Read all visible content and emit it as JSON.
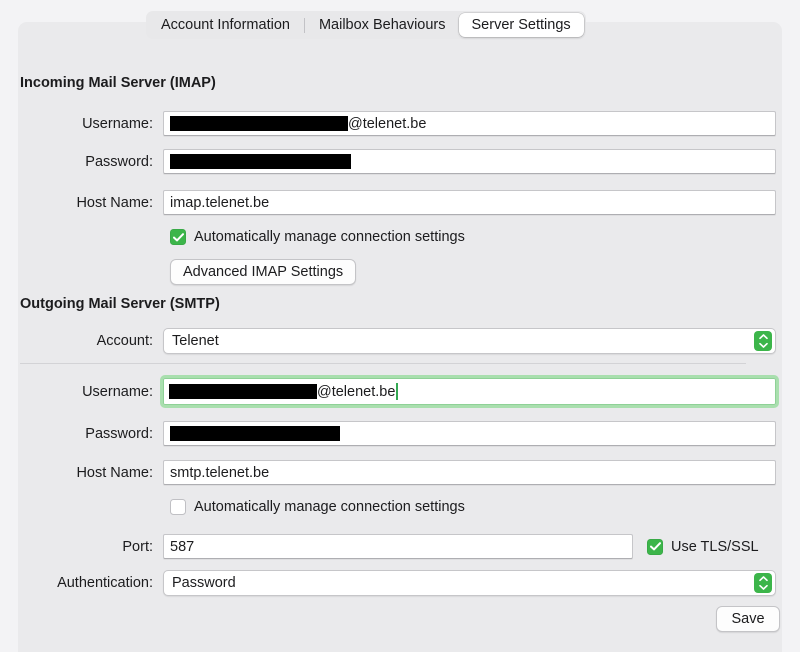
{
  "tabs": [
    {
      "label": "Account Information",
      "selected": false
    },
    {
      "label": "Mailbox Behaviours",
      "selected": false
    },
    {
      "label": "Server Settings",
      "selected": true
    }
  ],
  "incoming": {
    "title": "Incoming Mail Server (IMAP)",
    "username_label": "Username:",
    "username_value": "@telenet.be",
    "username_redacted": true,
    "password_label": "Password:",
    "password_value": "",
    "password_redacted": true,
    "hostname_label": "Host Name:",
    "hostname_value": "imap.telenet.be",
    "auto_manage_label": "Automatically manage connection settings",
    "auto_manage_checked": true,
    "advanced_button": "Advanced IMAP Settings"
  },
  "outgoing": {
    "title": "Outgoing Mail Server (SMTP)",
    "account_label": "Account:",
    "account_value": "Telenet",
    "username_label": "Username:",
    "username_value": "@telenet.be",
    "username_redacted": true,
    "username_focused": true,
    "password_label": "Password:",
    "password_value": "",
    "password_redacted": true,
    "hostname_label": "Host Name:",
    "hostname_value": "smtp.telenet.be",
    "auto_manage_label": "Automatically manage connection settings",
    "auto_manage_checked": false,
    "port_label": "Port:",
    "port_value": "587",
    "tls_label": "Use TLS/SSL",
    "tls_checked": true,
    "auth_label": "Authentication:",
    "auth_value": "Password"
  },
  "footer": {
    "save_label": "Save"
  },
  "colors": {
    "accent_green": "#3cb54a",
    "focus_ring": "#a9dfae",
    "panel_bg": "#eaeaec",
    "window_bg": "#f3f3f5"
  }
}
